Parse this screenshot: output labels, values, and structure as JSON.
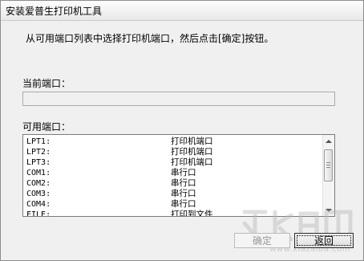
{
  "window": {
    "title": "安装爱普生打印机工具"
  },
  "instruction": "从可用端口列表中选择打印机端口，然后点击[确定]按钮。",
  "current_port": {
    "label": "当前端口：",
    "value": ""
  },
  "available_ports": {
    "label": "可用端口：",
    "rows": [
      {
        "port": "LPT1:",
        "desc": "打印机端口"
      },
      {
        "port": "LPT2:",
        "desc": "打印机端口"
      },
      {
        "port": "LPT3:",
        "desc": "打印机端口"
      },
      {
        "port": "COM1:",
        "desc": "串行口"
      },
      {
        "port": "COM2:",
        "desc": "串行口"
      },
      {
        "port": "COM3:",
        "desc": "串行口"
      },
      {
        "port": "COM4:",
        "desc": "串行口"
      },
      {
        "port": "FILE:",
        "desc": "打印到文件"
      }
    ]
  },
  "buttons": {
    "ok_label": "确定",
    "back_label": "返回"
  },
  "watermark": {
    "domain": "www.xiazaiba.com"
  }
}
